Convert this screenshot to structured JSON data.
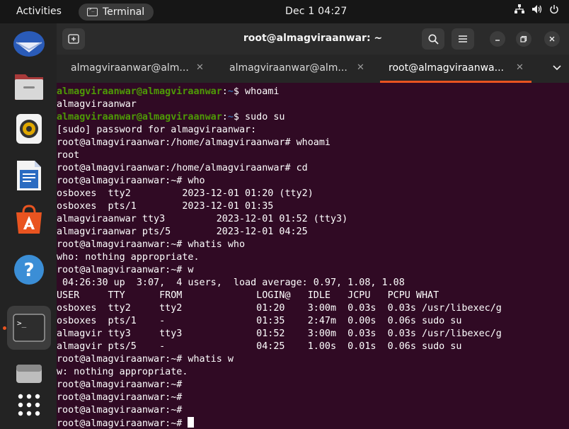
{
  "topbar": {
    "activities": "Activities",
    "app_name": "Terminal",
    "clock": "Dec 1  04:27",
    "tray_icons": [
      "network-icon",
      "volume-icon",
      "power-icon"
    ]
  },
  "dock": {
    "items": [
      "thunderbird-icon",
      "files-icon",
      "rhythmbox-icon",
      "writer-icon",
      "app-center-icon",
      "help-icon",
      "terminal-icon",
      "disk-icon",
      "show-apps-icon"
    ]
  },
  "window": {
    "title": "root@almagviraanwar: ~",
    "tabs": [
      {
        "label": "almagviraanwar@alm..."
      },
      {
        "label": "almagviraanwar@alm..."
      },
      {
        "label": "root@almagviraanwa..."
      }
    ]
  },
  "terminal": {
    "user_prompt_user": "almagviraanwar@almagviraanwar",
    "user_prompt_path": "~",
    "lines": [
      {
        "type": "user",
        "cmd": "$ whoami"
      },
      {
        "type": "out",
        "text": "almagviraanwar"
      },
      {
        "type": "user",
        "cmd": "$ sudo su"
      },
      {
        "type": "out",
        "text": "[sudo] password for almagviraanwar:"
      },
      {
        "type": "out",
        "text": "root@almagviraanwar:/home/almagviraanwar# whoami"
      },
      {
        "type": "out",
        "text": "root"
      },
      {
        "type": "out",
        "text": "root@almagviraanwar:/home/almagviraanwar# cd"
      },
      {
        "type": "out",
        "text": "root@almagviraanwar:~# who"
      },
      {
        "type": "out",
        "text": "osboxes  tty2         2023-12-01 01:20 (tty2)"
      },
      {
        "type": "out",
        "text": "osboxes  pts/1        2023-12-01 01:35"
      },
      {
        "type": "out",
        "text": "almagviraanwar tty3         2023-12-01 01:52 (tty3)"
      },
      {
        "type": "out",
        "text": "almagviraanwar pts/5        2023-12-01 04:25"
      },
      {
        "type": "out",
        "text": "root@almagviraanwar:~# whatis who"
      },
      {
        "type": "out",
        "text": "who: nothing appropriate."
      },
      {
        "type": "out",
        "text": "root@almagviraanwar:~# w"
      },
      {
        "type": "out",
        "text": " 04:26:30 up  3:07,  4 users,  load average: 0.97, 1.08, 1.08"
      },
      {
        "type": "out",
        "text": "USER     TTY      FROM             LOGIN@   IDLE   JCPU   PCPU WHAT"
      },
      {
        "type": "out",
        "text": "osboxes  tty2     tty2             01:20    3:00m  0.03s  0.03s /usr/libexec/g"
      },
      {
        "type": "out",
        "text": "osboxes  pts/1    -                01:35    2:47m  0.00s  0.06s sudo su"
      },
      {
        "type": "out",
        "text": "almagvir tty3     tty3             01:52    3:00m  0.03s  0.03s /usr/libexec/g"
      },
      {
        "type": "out",
        "text": "almagvir pts/5    -                04:25    1.00s  0.01s  0.06s sudo su"
      },
      {
        "type": "out",
        "text": "root@almagviraanwar:~# whatis w"
      },
      {
        "type": "out",
        "text": "w: nothing appropriate."
      },
      {
        "type": "out",
        "text": "root@almagviraanwar:~#"
      },
      {
        "type": "out",
        "text": "root@almagviraanwar:~#"
      },
      {
        "type": "out",
        "text": "root@almagviraanwar:~#"
      },
      {
        "type": "cursor",
        "text": "root@almagviraanwar:~# "
      }
    ]
  }
}
